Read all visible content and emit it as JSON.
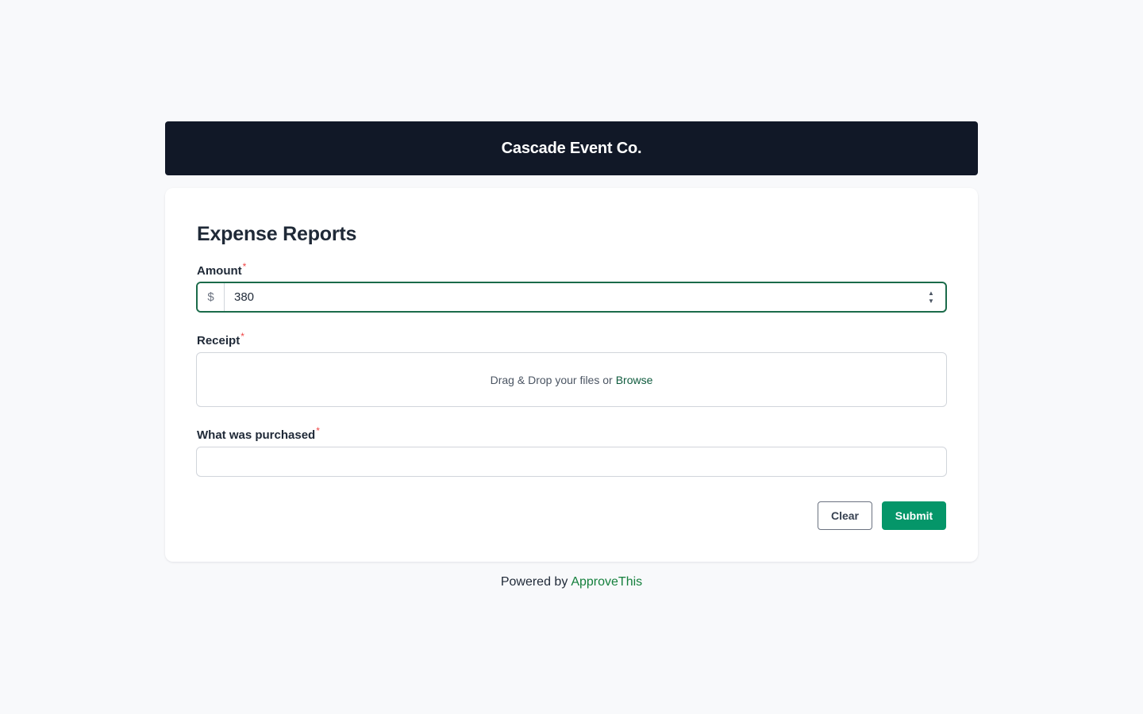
{
  "header": {
    "title": "Cascade Event Co."
  },
  "form": {
    "title": "Expense Reports",
    "amount": {
      "label": "Amount",
      "required_mark": "*",
      "prefix": "$",
      "value": "380",
      "spinner_up": "▲",
      "spinner_down": "▼"
    },
    "receipt": {
      "label": "Receipt",
      "required_mark": "*",
      "drop_text": "Drag & Drop your files or",
      "browse_label": "Browse"
    },
    "purchased": {
      "label": "What was purchased",
      "required_mark": "*",
      "value": ""
    },
    "buttons": {
      "clear": "Clear",
      "submit": "Submit"
    }
  },
  "footer": {
    "prefix": "Powered by",
    "link": "ApproveThis"
  },
  "colors": {
    "header_bg": "#111827",
    "accent": "#059669",
    "focus_border": "#1b6b4a",
    "required": "#ef4444"
  }
}
